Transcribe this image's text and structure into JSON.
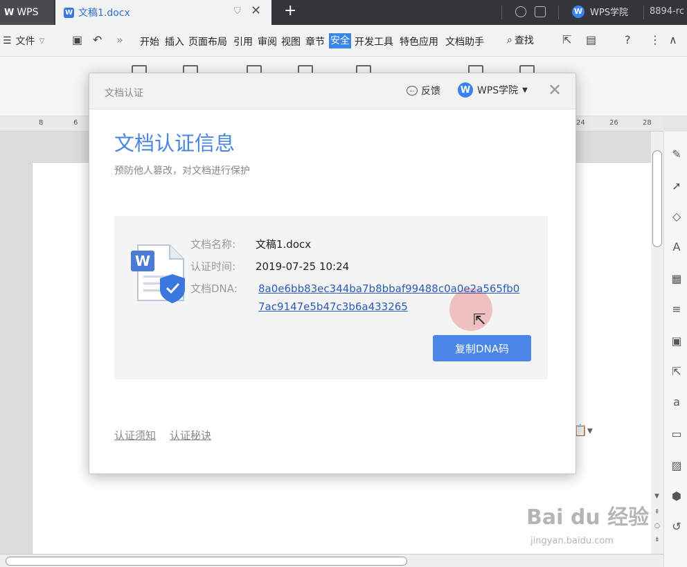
{
  "titlebar": {
    "app_tab": "WPS",
    "app_logo": "W",
    "doc_tab": "文稿1.docx",
    "doc_badge": "W",
    "new_tab": "+",
    "academy": "WPS学院",
    "academy_logo": "W",
    "user": "8894-rc"
  },
  "menubar": {
    "file": "文件",
    "items": [
      "开始",
      "插入",
      "页面布局",
      "引用",
      "审阅",
      "视图",
      "章节",
      "安全",
      "开发工具",
      "特色应用",
      "文档助手"
    ],
    "active": "安全",
    "search": "查找",
    "help": "?"
  },
  "ruler": {
    "ticks_left": [
      "8",
      "6"
    ],
    "ticks_right": [
      "24",
      "26",
      "28"
    ]
  },
  "dialog": {
    "title": "文档认证",
    "feedback": "反馈",
    "academy": "WPS学院",
    "academy_logo": "W",
    "heading": "文档认证信息",
    "subtitle": "预防他人篡改，对文档进行保护",
    "doc_name_label": "文档名称:",
    "doc_name": "文稿1.docx",
    "time_label": "认证时间:",
    "time": "2019-07-25 10:24",
    "dna_label": "文档DNA:",
    "dna": "8a0e6bb83ec344ba7b8bbaf99488c0a0e2a565fb07ac9147e5b47c3b6a433265",
    "copy_button": "复制DNA码",
    "footer_links": [
      "认证须知",
      "认证秘诀"
    ]
  },
  "watermark": {
    "main": "Bai du 经验",
    "sub": "jingyan.baidu.com"
  },
  "colors": {
    "accent": "#4a86e8",
    "titlebar": "#34353a"
  },
  "icons": {
    "right_panel": [
      "pen-icon",
      "cursor-icon",
      "shapes-icon",
      "style-icon",
      "table-icon",
      "sliders-icon",
      "gallery-icon",
      "share-icon",
      "translate-icon",
      "archive-icon",
      "image-icon",
      "shield-icon",
      "history-icon"
    ]
  }
}
